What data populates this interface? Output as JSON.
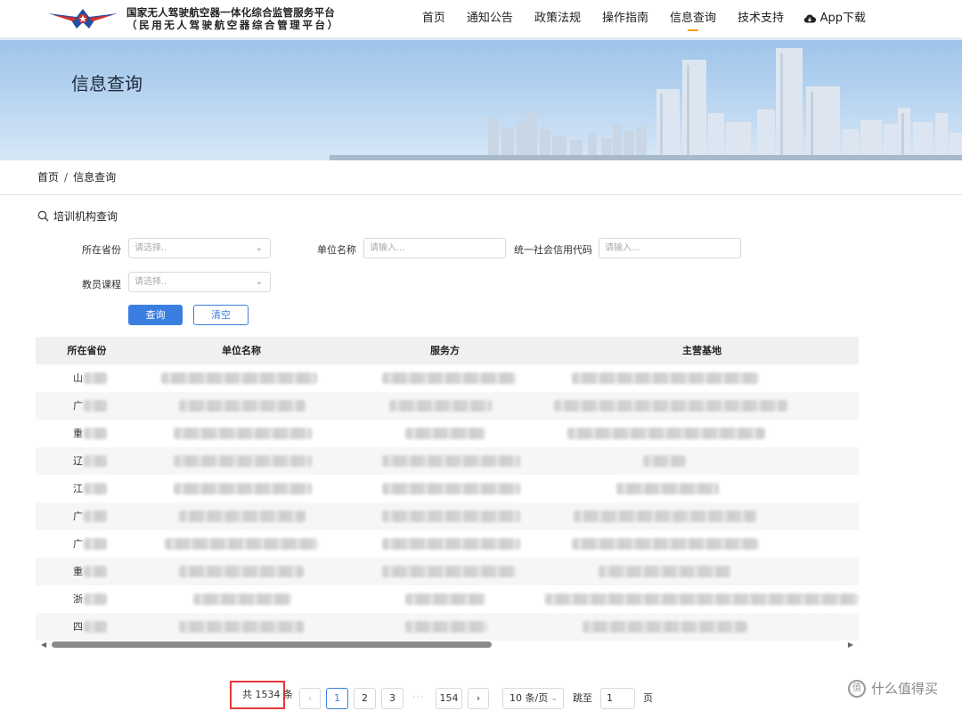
{
  "header": {
    "title_line1": "国家无人驾驶航空器一体化综合监管服务平台",
    "title_line2": "（民用无人驾驶航空器综合管理平台）",
    "nav": [
      {
        "label": "首页",
        "active": false
      },
      {
        "label": "通知公告",
        "active": false
      },
      {
        "label": "政策法规",
        "active": false
      },
      {
        "label": "操作指南",
        "active": false
      },
      {
        "label": "信息查询",
        "active": true
      },
      {
        "label": "技术支持",
        "active": false
      }
    ],
    "app_download": "App下载"
  },
  "banner": {
    "title": "信息查询"
  },
  "breadcrumb": {
    "home": "首页",
    "separator": "/",
    "current": "信息查询"
  },
  "search": {
    "section_title": "培训机构查询",
    "province_label": "所在省份",
    "province_placeholder": "请选择..",
    "unit_label": "单位名称",
    "unit_placeholder": "请输入...",
    "credit_label": "统一社会信用代码",
    "credit_placeholder": "请输入...",
    "course_label": "教员课程",
    "course_placeholder": "请选择..",
    "query_button": "查询",
    "clear_button": "清空"
  },
  "table": {
    "headers": [
      "所在省份",
      "单位名称",
      "服务方",
      "主营基地"
    ],
    "rows": [
      {
        "province": "山"
      },
      {
        "province": "广"
      },
      {
        "province": "重"
      },
      {
        "province": "辽"
      },
      {
        "province": "江"
      },
      {
        "province": "广"
      },
      {
        "province": "广"
      },
      {
        "province": "重"
      },
      {
        "province": "浙"
      },
      {
        "province": "四"
      }
    ]
  },
  "pagination": {
    "total": "共 1534 条",
    "prev": "‹",
    "pages": [
      "1",
      "2",
      "3"
    ],
    "ellipsis": "···",
    "last_page": "154",
    "next": "›",
    "page_size": "10 条/页",
    "jump_label": "跳至",
    "jump_value": "1",
    "page_unit": "页"
  },
  "watermark": {
    "icon_glyph": "值",
    "text": "什么值得买"
  },
  "colors": {
    "accent": "#3a7fe0",
    "nav_underline": "#f2a01b",
    "highlight_box": "#e53935"
  }
}
